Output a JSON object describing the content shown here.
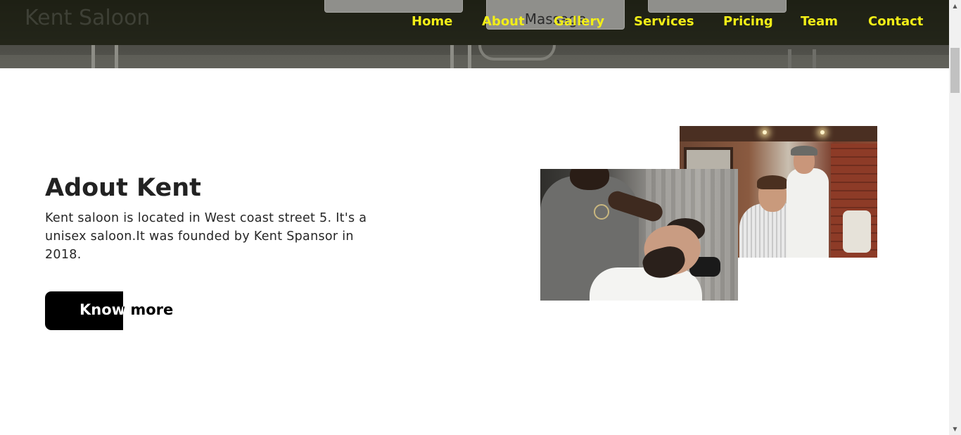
{
  "navbar": {
    "brand": "Kent Saloon",
    "service_tabs": [
      "",
      "Massage",
      ""
    ],
    "links": [
      "Home",
      "About",
      "Gallery",
      "Services",
      "Pricing",
      "Team",
      "Contact"
    ]
  },
  "about": {
    "title": "Adout Kent",
    "description": "Kent saloon is located in West coast street 5. It's a unisex saloon.It was founded by Kent Spansor in 2018.",
    "button_label": "Know more"
  },
  "colors": {
    "nav_link": "#f2ee17",
    "button_bg": "#000000",
    "page_bg": "#ffffff"
  },
  "icons": {
    "scroll_up": "scroll-up-arrow-icon",
    "scroll_down": "scroll-down-arrow-icon"
  }
}
